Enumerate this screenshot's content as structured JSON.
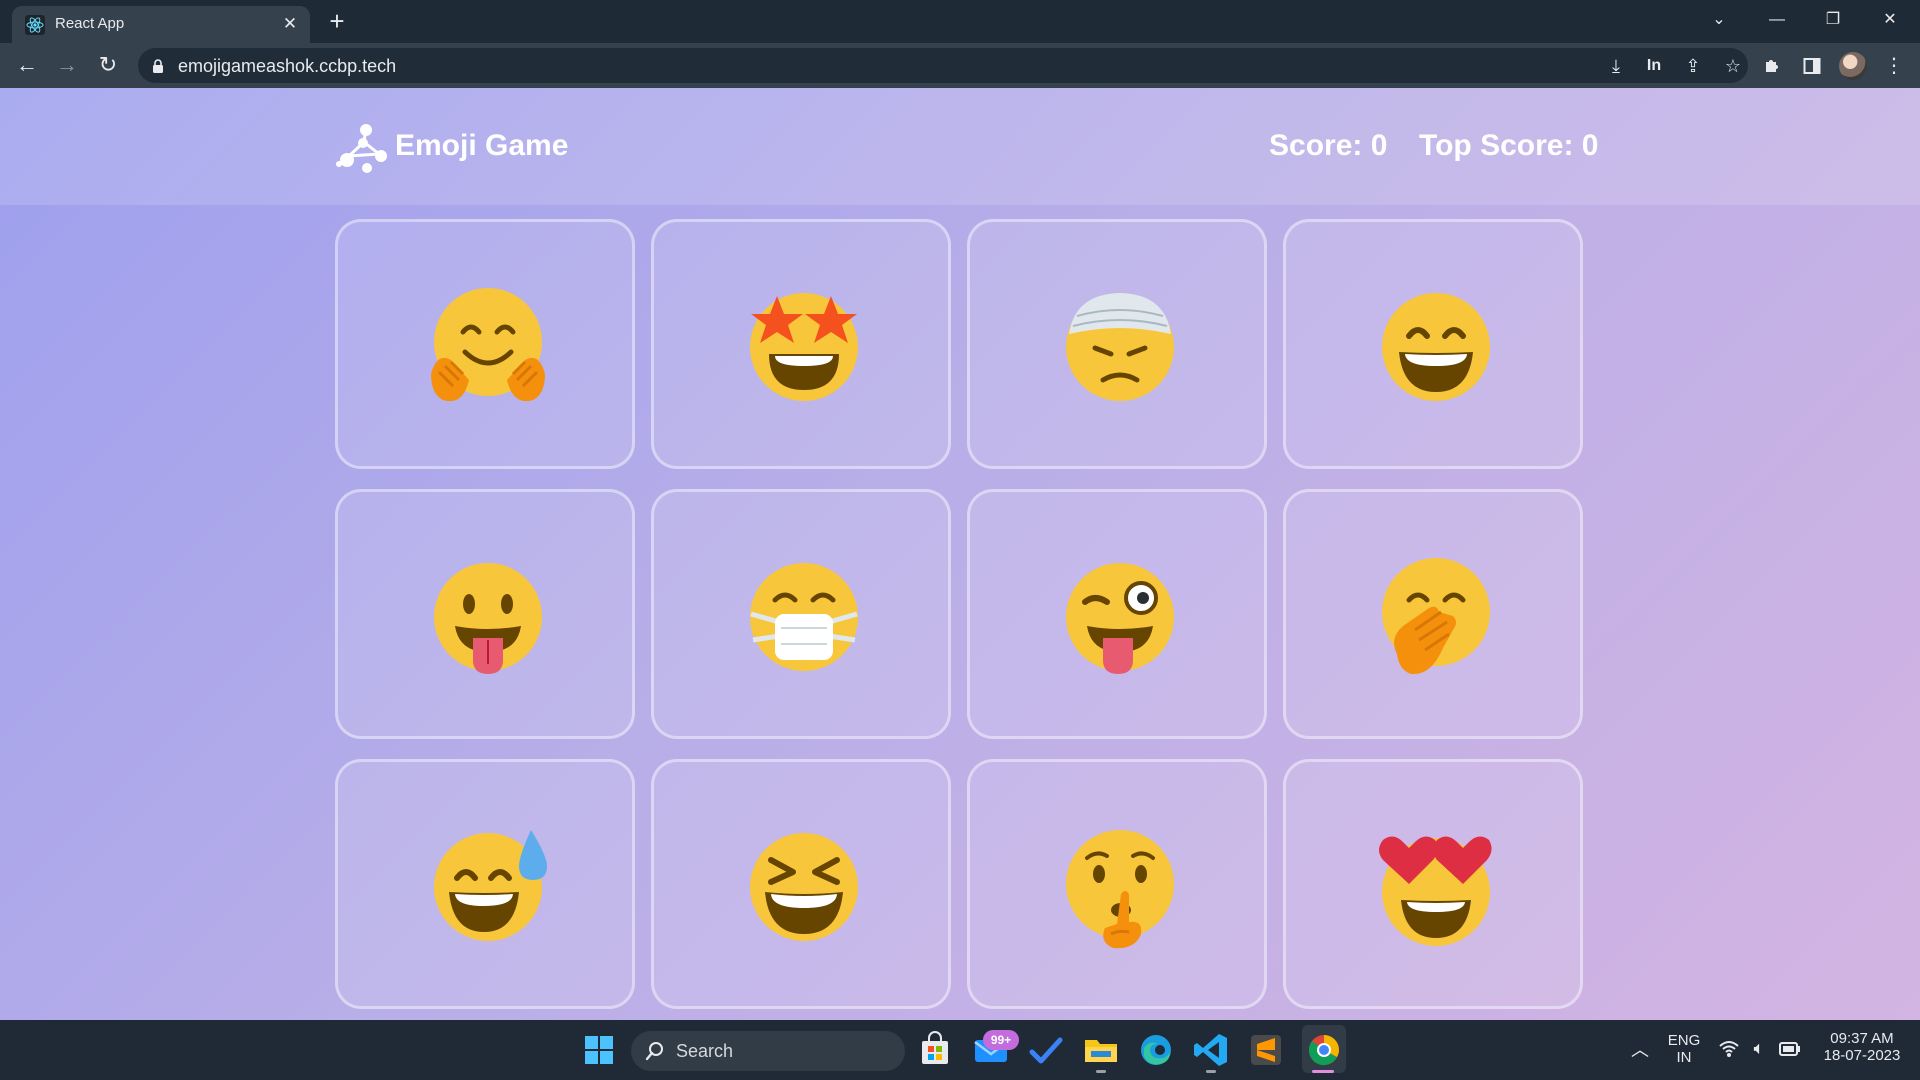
{
  "browser": {
    "tab_title": "React App",
    "url": "emojigameashok.ccbp.tech",
    "close_glyph": "✕",
    "new_tab_glyph": "+",
    "reader_label": "In"
  },
  "app": {
    "title": "Emoji Game",
    "score_label": "Score: 0",
    "top_score_label": "Top Score: 0",
    "score": 0,
    "top_score": 0
  },
  "emojis": [
    {
      "id": 0,
      "name": "hugging-face"
    },
    {
      "id": 1,
      "name": "star-struck"
    },
    {
      "id": 2,
      "name": "face-with-head-bandage"
    },
    {
      "id": 3,
      "name": "grinning-face-with-smiling-eyes"
    },
    {
      "id": 4,
      "name": "face-with-tongue"
    },
    {
      "id": 5,
      "name": "face-with-medical-mask"
    },
    {
      "id": 6,
      "name": "winking-face-with-tongue"
    },
    {
      "id": 7,
      "name": "face-with-hand-over-mouth"
    },
    {
      "id": 8,
      "name": "grinning-face-with-sweat"
    },
    {
      "id": 9,
      "name": "grinning-squinting-face"
    },
    {
      "id": 10,
      "name": "shushing-face"
    },
    {
      "id": 11,
      "name": "smiling-face-with-heart-eyes"
    }
  ],
  "taskbar": {
    "search_label": "Search",
    "mail_badge": "99+",
    "lang_line1": "ENG",
    "lang_line2": "IN",
    "time": "09:37 AM",
    "date": "18-07-2023"
  },
  "colors": {
    "emoji_yellow": "#f8c63b",
    "emoji_brown": "#664500",
    "hand_orange": "#f5900c",
    "tongue_pink": "#e75a70",
    "heart_red": "#dd2e44"
  }
}
